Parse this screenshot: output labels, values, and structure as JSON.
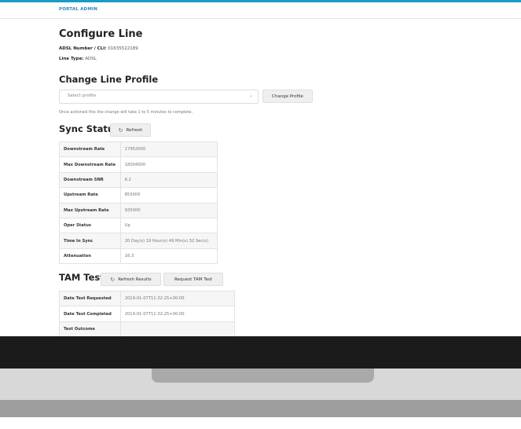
{
  "nav": {
    "brand": "PORTAL ADMIN"
  },
  "page": {
    "title": "Configure Line",
    "adsl_label": "ADSL Number / CLI:",
    "adsl_value": "01635522189",
    "line_type_label": "Line Type:",
    "line_type_value": "ADSL"
  },
  "change_profile": {
    "heading": "Change Line Profile",
    "select_placeholder": "Select profile",
    "button": "Change Profile",
    "note": "Once actioned this the change will take 1 to 5 minutes to complete."
  },
  "sync": {
    "heading": "Sync Status",
    "refresh": "Refresh",
    "rows": [
      {
        "label": "Downstream Rate",
        "value": "17952000"
      },
      {
        "label": "Max Downstream Rate",
        "value": "18004000"
      },
      {
        "label": "Downstream SNR",
        "value": "6.2"
      },
      {
        "label": "Upstream Rate",
        "value": "855000"
      },
      {
        "label": "Max Upstream Rate",
        "value": "935000"
      },
      {
        "label": "Oper Status",
        "value": "Up"
      },
      {
        "label": "Time In Sync",
        "value": "20 Day(s) 19 Hour(s) 49 Min(s) 32 Sec(s)"
      },
      {
        "label": "Attenuation",
        "value": "16.3"
      }
    ]
  },
  "tam": {
    "heading": "TAM Test",
    "refresh_results": "Refresh Results",
    "request": "Request TAM Test",
    "rows": [
      {
        "label": "Date Test Requested",
        "value": "2019-01-07T11:32:25+00:00"
      },
      {
        "label": "Date Test Completed",
        "value": "2019-01-07T11:32:25+00:00"
      },
      {
        "label": "Test Outcome",
        "value": ""
      }
    ]
  },
  "colors": {
    "accent": "#1a9bc4",
    "brand_text": "#2a88b8"
  },
  "icons": {
    "refresh": "refresh-icon",
    "chevron": "chevron-down-icon"
  }
}
